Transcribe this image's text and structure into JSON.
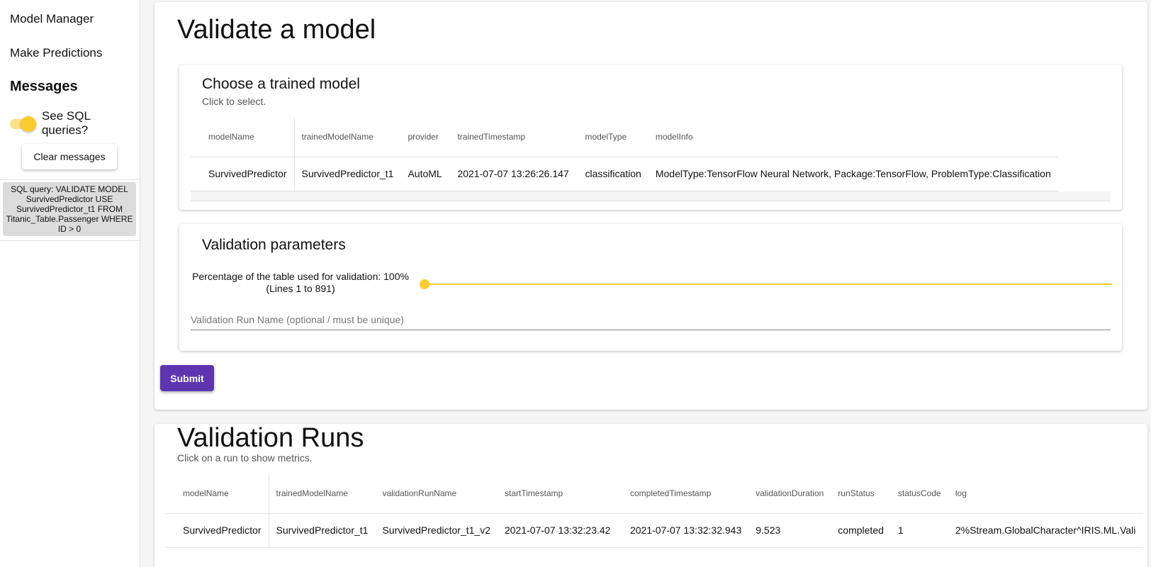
{
  "sidebar": {
    "nav": [
      "Model Manager",
      "Make Predictions"
    ],
    "messages_title": "Messages",
    "toggle_label": "See SQL queries?",
    "toggle_on": true,
    "clear_button": "Clear messages",
    "sql_message": "SQL query: VALIDATE MODEL SurvivedPredictor USE SurvivedPredictor_t1 FROM Titanic_Table.Passenger WHERE ID > 0"
  },
  "validate": {
    "title": "Validate a model",
    "choose_card": {
      "title": "Choose a trained model",
      "subtitle": "Click to select.",
      "columns": [
        "modelName",
        "trainedModelName",
        "provider",
        "trainedTimestamp",
        "modelType",
        "modelInfo"
      ],
      "rows": [
        [
          "SurvivedPredictor",
          "SurvivedPredictor_t1",
          "AutoML",
          "2021-07-07 13:26:26.147",
          "classification",
          "ModelType:TensorFlow Neural Network, Package:TensorFlow, ProblemType:Classification"
        ]
      ]
    },
    "params_card": {
      "title": "Validation parameters",
      "slider_label_line1": "Percentage of the table used for validation: 100%",
      "slider_label_line2": "(Lines 1 to 891)",
      "slider_value_percent": 100,
      "run_name_placeholder": "Validation Run Name (optional / must be unique)"
    },
    "submit_label": "Submit"
  },
  "runs": {
    "title": "Validation Runs",
    "subtitle": "Click on a run to show metrics.",
    "columns": [
      "modelName",
      "trainedModelName",
      "validationRunName",
      "startTimestamp",
      "completedTimestamp",
      "validationDuration",
      "runStatus",
      "statusCode",
      "log"
    ],
    "rows": [
      [
        "SurvivedPredictor",
        "SurvivedPredictor_t1",
        "SurvivedPredictor_t1_v2",
        "2021-07-07 13:32:23.42",
        "2021-07-07 13:32:32.943",
        "9.523",
        "completed",
        "1",
        "2%Stream.GlobalCharacter^IRIS.ML.Vali"
      ]
    ]
  },
  "colors": {
    "accent_yellow": "#fccc2c",
    "submit_purple": "#5e35b1"
  }
}
